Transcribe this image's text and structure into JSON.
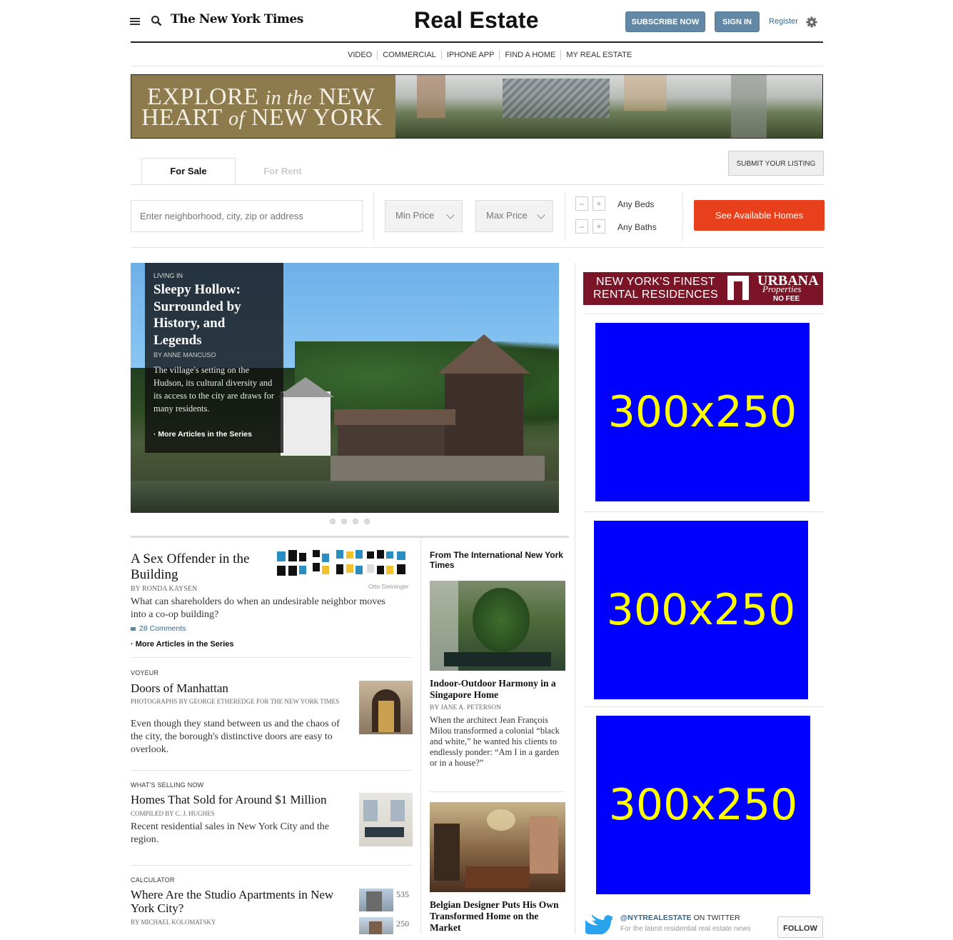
{
  "masthead": {
    "logo": "The New York Times",
    "section_title": "Real Estate",
    "subscribe_label": "SUBSCRIBE NOW",
    "signin_label": "SIGN IN",
    "register_label": "Register"
  },
  "nav": {
    "items": [
      "VIDEO",
      "COMMERCIAL",
      "IPHONE APP",
      "FIND A HOME",
      "MY REAL ESTATE"
    ]
  },
  "banner": {
    "line1_a": "EXPLORE ",
    "line1_b": "in the",
    "line1_c": " NEW",
    "line2_a": "HEART ",
    "line2_b": "of",
    "line2_c": " NEW YORK"
  },
  "search": {
    "tab_sale": "For Sale",
    "tab_rent": "For Rent",
    "submit_listing": "SUBMIT YOUR LISTING",
    "placeholder": "Enter neighborhood, city, zip or address",
    "min_price": "Min Price",
    "max_price": "Max Price",
    "beds": "Any Beds",
    "baths": "Any Baths",
    "minus": "–",
    "plus": "+",
    "see_homes": "See Available Homes"
  },
  "hero": {
    "kicker": "LIVING IN",
    "title": "Sleepy Hollow: Surrounded by History, and Legends",
    "byline": "By ANNE MANCUSO",
    "summary": "The village's setting on the Hudson, its cultural diversity and its access to the city are draws for many residents.",
    "more": "More Articles in the Series"
  },
  "stories": {
    "s1": {
      "title": "A Sex Offender in the Building",
      "credit": "Otto Steininger",
      "byline": "By RONDA KAYSEN",
      "summary": "What can shareholders do when an undesirable neighbor moves into a co-op building?",
      "comments": "28 Comments",
      "more": "More Articles in the Series"
    },
    "s2": {
      "kicker": "VOYEUR",
      "title": "Doors of Manhattan",
      "byline": "Photographs by GEORGE ETHEREDGE for THE NEW YORK TIMES",
      "summary": "Even though they stand between us and the chaos of the city, the borough's distinctive doors are easy to overlook."
    },
    "s3": {
      "kicker": "WHAT'S SELLING NOW",
      "title": "Homes That Sold for Around $1 Million",
      "byline": "Compiled by C. J. HUGHES",
      "summary": "Recent residential sales in New York City and the region."
    },
    "s4": {
      "kicker": "CALCULATOR",
      "title": "Where Are the Studio Apartments in New York City?",
      "byline": "By MICHAEL KOLOMATSKY",
      "num1": "535",
      "num2": "250"
    }
  },
  "intl": {
    "heading": "From The International New York Times",
    "a1_title": "Indoor-Outdoor Harmony in a Singapore Home",
    "a1_byline": "By JANE A. PETERSON",
    "a1_summary": "When the architect Jean François Milou transformed a colonial “black and white,” he wanted his clients to endlessly ponder: “Am I in a garden or in a house?”",
    "a2_title": "Belgian Designer Puts His Own Transformed Home on the Market"
  },
  "ads": {
    "urbana_line1": "NEW YORK'S FINEST",
    "urbana_line2": "RENTAL RESIDENCES",
    "urbana_brand": "URBANA",
    "urbana_sub": "Properties",
    "urbana_nofee": "NO FEE",
    "box1": "300x250",
    "box2": "300x250",
    "box3": "300x250"
  },
  "twitter": {
    "handle": "@NYTREALESTATE",
    "on": " ON TWITTER",
    "tagline": "For the latest residential real estate news",
    "follow": "FOLLOW"
  },
  "colors": {
    "accent_red": "#e8401c",
    "header_button": "#6288a5",
    "ad_blue": "#0000ff",
    "ad_yellow": "#ffff00",
    "urbana_maroon": "#7a1426"
  }
}
